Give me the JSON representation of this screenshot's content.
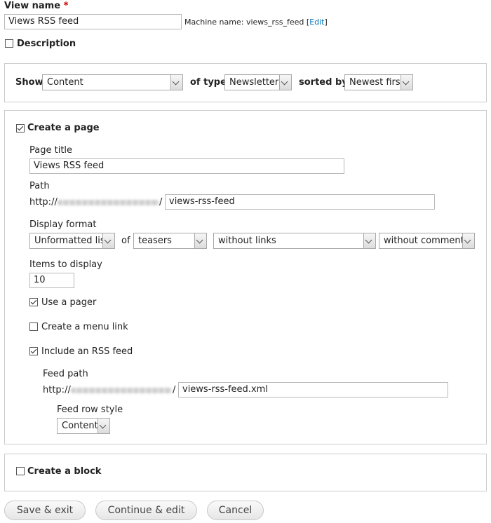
{
  "view_name": {
    "label": "View name",
    "required_mark": "*",
    "value": "Views RSS feed",
    "machine_name_label": "Machine name: views_rss_feed",
    "edit_open": "[",
    "edit_link": "Edit",
    "edit_close": "]"
  },
  "description": {
    "label": "Description",
    "checked": false
  },
  "show": {
    "show_label": "Show",
    "show_value": "Content",
    "of_type_label": "of type",
    "of_type_value": "Newsletter",
    "sorted_by_label": "sorted by",
    "sorted_by_value": "Newest first"
  },
  "page": {
    "create_label": "Create a page",
    "page_title_label": "Page title",
    "page_title_value": "Views RSS feed",
    "path_label": "Path",
    "path_prefix": "http://",
    "path_slash": "/",
    "path_value": "views-rss-feed",
    "display_format_label": "Display format",
    "format_value": "Unformatted list",
    "of_label": "of",
    "teasers_value": "teasers",
    "links_value": "without links",
    "comments_value": "without comments",
    "items_label": "Items to display",
    "items_value": "10",
    "use_pager_label": "Use a pager",
    "menu_link_label": "Create a menu link",
    "rss_label": "Include an RSS feed",
    "feed_path_label": "Feed path",
    "feed_prefix": "http://",
    "feed_slash": "/",
    "feed_value": "views-rss-feed.xml",
    "feed_row_style_label": "Feed row style",
    "feed_row_style_value": "Content"
  },
  "block": {
    "create_label": "Create a block"
  },
  "buttons": {
    "save": "Save & exit",
    "continue": "Continue & edit",
    "cancel": "Cancel"
  }
}
